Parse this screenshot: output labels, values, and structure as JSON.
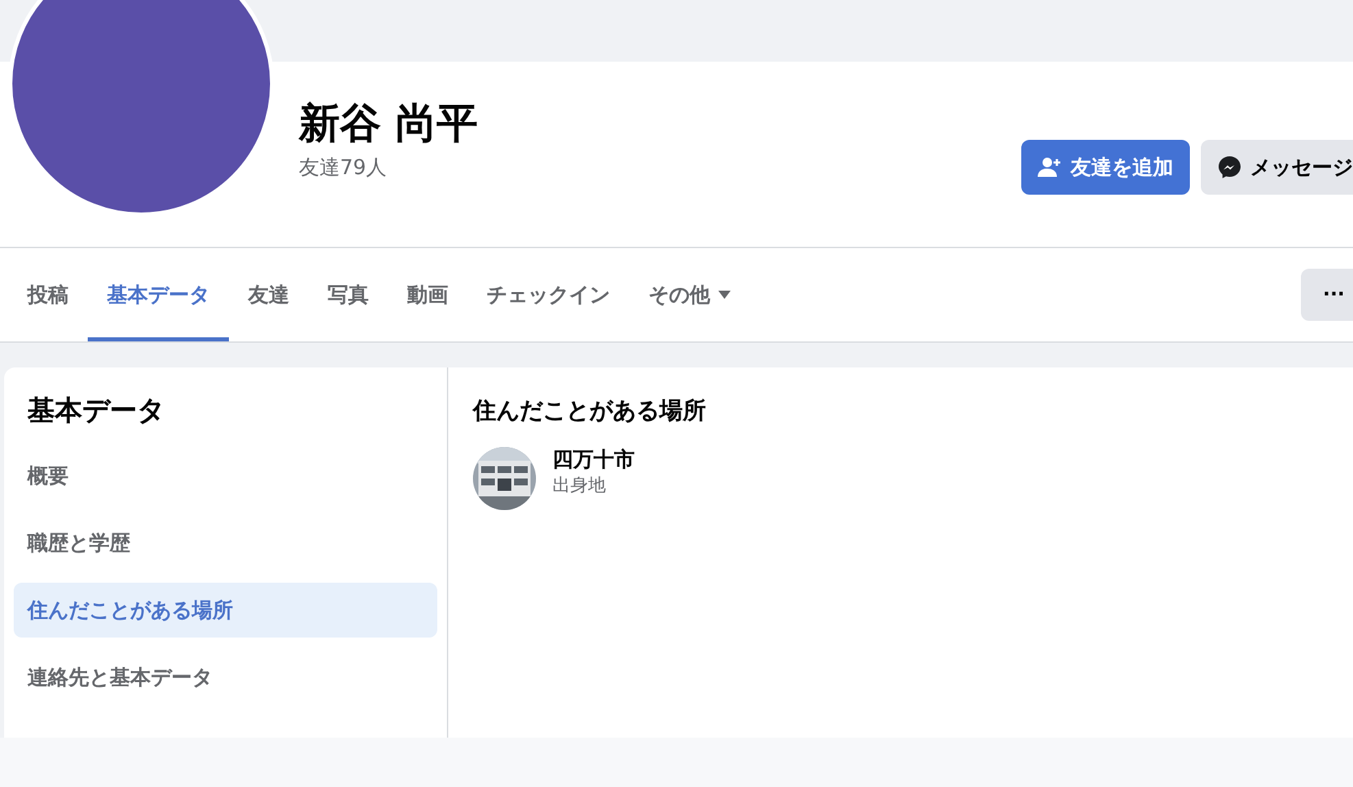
{
  "profile": {
    "name": "新谷 尚平",
    "friends_count": "友達79人"
  },
  "actions": [
    {
      "kind": "add_friend",
      "label": "友達を追加"
    },
    {
      "kind": "message",
      "label": "メッセージ"
    }
  ],
  "tabs": [
    {
      "label": "投稿",
      "selected": false,
      "dropdown": false
    },
    {
      "label": "基本データ",
      "selected": true,
      "dropdown": false
    },
    {
      "label": "友達",
      "selected": false,
      "dropdown": false
    },
    {
      "label": "写真",
      "selected": false,
      "dropdown": false
    },
    {
      "label": "動画",
      "selected": false,
      "dropdown": false
    },
    {
      "label": "チェックイン",
      "selected": false,
      "dropdown": false
    },
    {
      "label": "その他",
      "selected": false,
      "dropdown": true
    }
  ],
  "more_button": "···",
  "sidebar": {
    "title": "基本データ",
    "items": [
      {
        "label": "概要",
        "selected": false
      },
      {
        "label": "職歴と学歴",
        "selected": false
      },
      {
        "label": "住んだことがある場所",
        "selected": true
      },
      {
        "label": "連絡先と基本データ",
        "selected": false
      }
    ]
  },
  "section": {
    "title": "住んだことがある場所",
    "places": [
      {
        "name": "四万十市",
        "caption": "出身地",
        "kind": "picture"
      }
    ]
  }
}
